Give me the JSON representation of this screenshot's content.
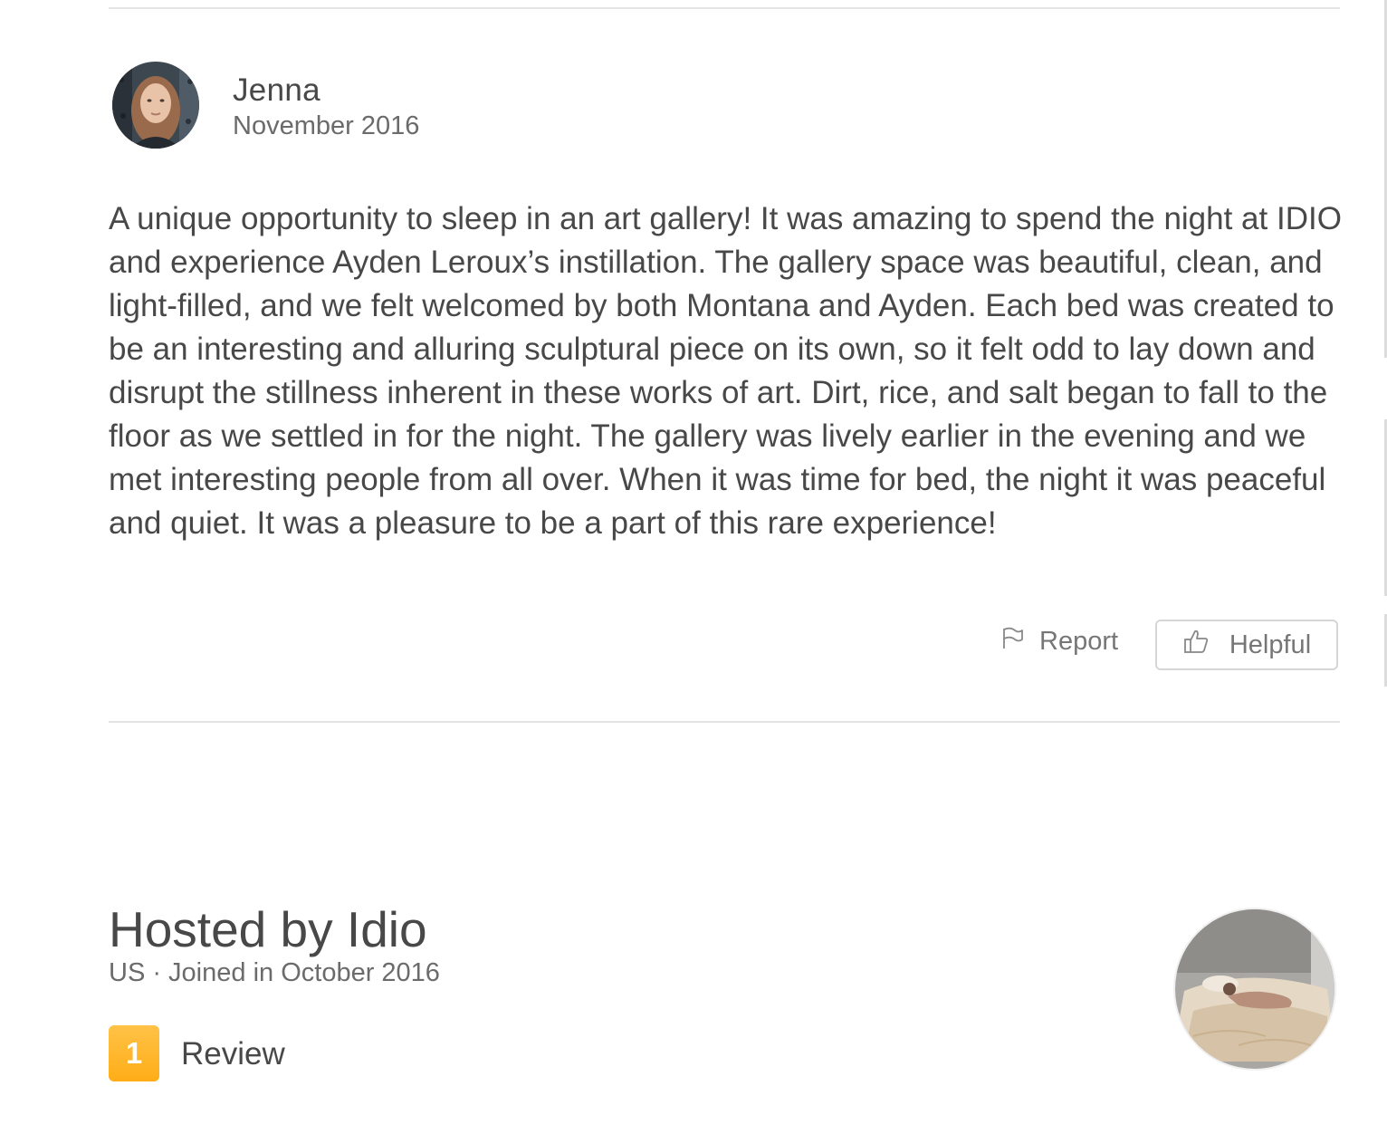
{
  "review": {
    "reviewer_name": "Jenna",
    "date": "November 2016",
    "text": "A unique opportunity to sleep in an art gallery! It was amazing to spend the night at IDIO and experience Ayden Leroux’s instillation. The gallery space was beautiful, clean, and light-filled, and we felt welcomed by both Montana and Ayden. Each bed was created to be an interesting and alluring sculptural piece on its own, so it felt odd to lay down and disrupt the stillness inherent in these works of art. Dirt, rice, and salt began to fall to the floor as we settled in for the night. The gallery was lively earlier in the evening and we met interesting people from all over. When it was time for bed, the night it was peaceful and quiet. It was a pleasure to be a part of this rare experience!",
    "report_label": "Report",
    "report_icon": "flag-icon",
    "helpful_label": "Helpful",
    "helpful_icon": "thumbs-up-icon"
  },
  "host": {
    "title": "Hosted by Idio",
    "meta": "US · Joined in October 2016",
    "review_count": "1",
    "review_label": "Review"
  },
  "colors": {
    "badge": "#ffb400",
    "text": "#484848",
    "muted": "#767676",
    "divider": "#e4e4e4"
  }
}
